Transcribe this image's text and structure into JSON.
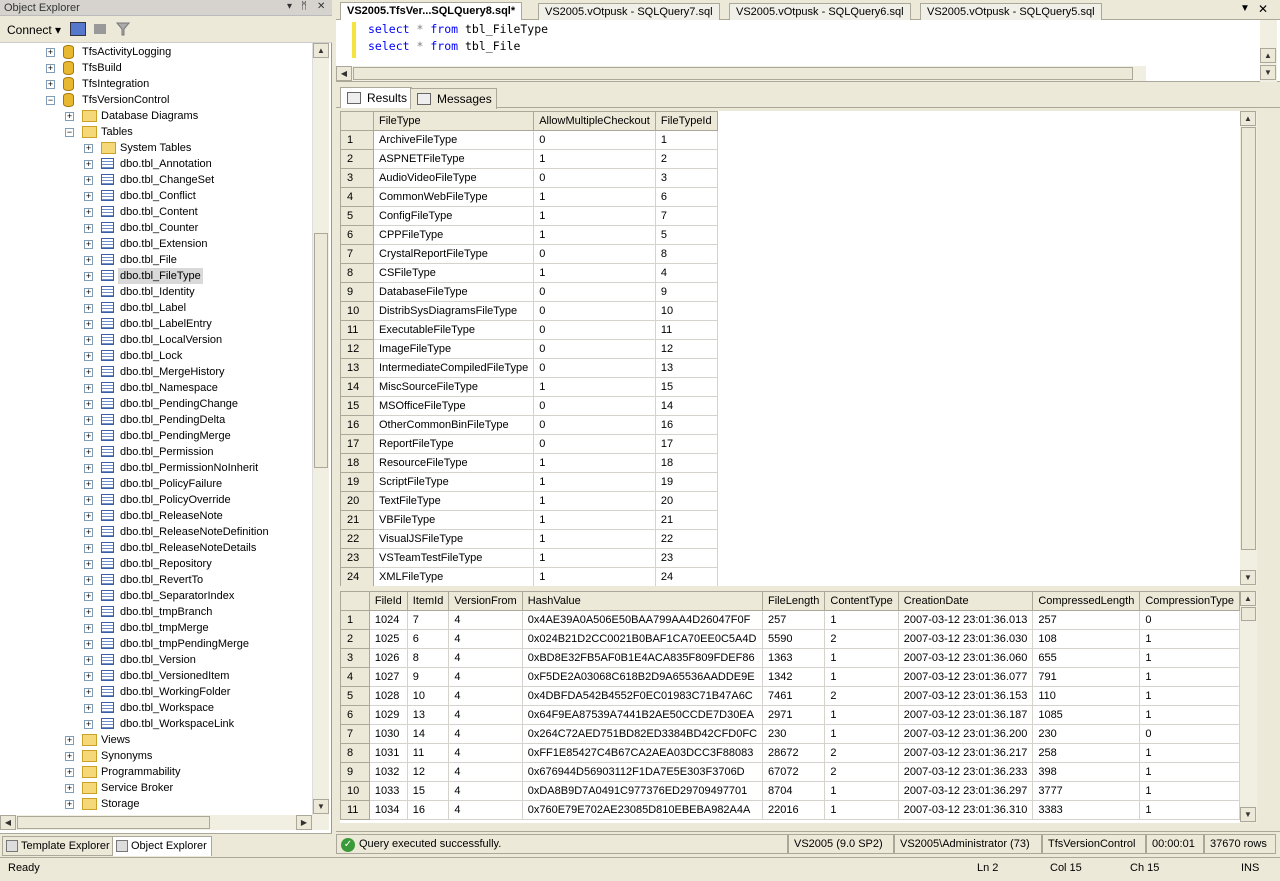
{
  "object_explorer": {
    "title": "Object Explorer",
    "title_controls": [
      "▾",
      "ᛗ",
      "✕"
    ],
    "connect_label": "Connect ▾",
    "tree": [
      {
        "label": "TfsActivityLogging",
        "level": 0,
        "icon": "database-icon",
        "expander": "+"
      },
      {
        "label": "TfsBuild",
        "level": 0,
        "icon": "database-icon",
        "expander": "+"
      },
      {
        "label": "TfsIntegration",
        "level": 0,
        "icon": "database-icon",
        "expander": "+"
      },
      {
        "label": "TfsVersionControl",
        "level": 0,
        "icon": "database-icon",
        "expander": "−"
      },
      {
        "label": "Database Diagrams",
        "level": 1,
        "icon": "folder-icon",
        "expander": "+"
      },
      {
        "label": "Tables",
        "level": 1,
        "icon": "folder-icon",
        "expander": "−"
      },
      {
        "label": "System Tables",
        "level": 2,
        "icon": "folder-icon",
        "expander": "+"
      },
      {
        "label": "dbo.tbl_Annotation",
        "level": 2,
        "icon": "table-icon",
        "expander": "+"
      },
      {
        "label": "dbo.tbl_ChangeSet",
        "level": 2,
        "icon": "table-icon",
        "expander": "+"
      },
      {
        "label": "dbo.tbl_Conflict",
        "level": 2,
        "icon": "table-icon",
        "expander": "+"
      },
      {
        "label": "dbo.tbl_Content",
        "level": 2,
        "icon": "table-icon",
        "expander": "+"
      },
      {
        "label": "dbo.tbl_Counter",
        "level": 2,
        "icon": "table-icon",
        "expander": "+"
      },
      {
        "label": "dbo.tbl_Extension",
        "level": 2,
        "icon": "table-icon",
        "expander": "+"
      },
      {
        "label": "dbo.tbl_File",
        "level": 2,
        "icon": "table-icon",
        "expander": "+"
      },
      {
        "label": "dbo.tbl_FileType",
        "level": 2,
        "icon": "table-icon",
        "expander": "+",
        "selected": true
      },
      {
        "label": "dbo.tbl_Identity",
        "level": 2,
        "icon": "table-icon",
        "expander": "+"
      },
      {
        "label": "dbo.tbl_Label",
        "level": 2,
        "icon": "table-icon",
        "expander": "+"
      },
      {
        "label": "dbo.tbl_LabelEntry",
        "level": 2,
        "icon": "table-icon",
        "expander": "+"
      },
      {
        "label": "dbo.tbl_LocalVersion",
        "level": 2,
        "icon": "table-icon",
        "expander": "+"
      },
      {
        "label": "dbo.tbl_Lock",
        "level": 2,
        "icon": "table-icon",
        "expander": "+"
      },
      {
        "label": "dbo.tbl_MergeHistory",
        "level": 2,
        "icon": "table-icon",
        "expander": "+"
      },
      {
        "label": "dbo.tbl_Namespace",
        "level": 2,
        "icon": "table-icon",
        "expander": "+"
      },
      {
        "label": "dbo.tbl_PendingChange",
        "level": 2,
        "icon": "table-icon",
        "expander": "+"
      },
      {
        "label": "dbo.tbl_PendingDelta",
        "level": 2,
        "icon": "table-icon",
        "expander": "+"
      },
      {
        "label": "dbo.tbl_PendingMerge",
        "level": 2,
        "icon": "table-icon",
        "expander": "+"
      },
      {
        "label": "dbo.tbl_Permission",
        "level": 2,
        "icon": "table-icon",
        "expander": "+"
      },
      {
        "label": "dbo.tbl_PermissionNoInherit",
        "level": 2,
        "icon": "table-icon",
        "expander": "+"
      },
      {
        "label": "dbo.tbl_PolicyFailure",
        "level": 2,
        "icon": "table-icon",
        "expander": "+"
      },
      {
        "label": "dbo.tbl_PolicyOverride",
        "level": 2,
        "icon": "table-icon",
        "expander": "+"
      },
      {
        "label": "dbo.tbl_ReleaseNote",
        "level": 2,
        "icon": "table-icon",
        "expander": "+"
      },
      {
        "label": "dbo.tbl_ReleaseNoteDefinition",
        "level": 2,
        "icon": "table-icon",
        "expander": "+"
      },
      {
        "label": "dbo.tbl_ReleaseNoteDetails",
        "level": 2,
        "icon": "table-icon",
        "expander": "+"
      },
      {
        "label": "dbo.tbl_Repository",
        "level": 2,
        "icon": "table-icon",
        "expander": "+"
      },
      {
        "label": "dbo.tbl_RevertTo",
        "level": 2,
        "icon": "table-icon",
        "expander": "+"
      },
      {
        "label": "dbo.tbl_SeparatorIndex",
        "level": 2,
        "icon": "table-icon",
        "expander": "+"
      },
      {
        "label": "dbo.tbl_tmpBranch",
        "level": 2,
        "icon": "table-icon",
        "expander": "+"
      },
      {
        "label": "dbo.tbl_tmpMerge",
        "level": 2,
        "icon": "table-icon",
        "expander": "+"
      },
      {
        "label": "dbo.tbl_tmpPendingMerge",
        "level": 2,
        "icon": "table-icon",
        "expander": "+"
      },
      {
        "label": "dbo.tbl_Version",
        "level": 2,
        "icon": "table-icon",
        "expander": "+"
      },
      {
        "label": "dbo.tbl_VersionedItem",
        "level": 2,
        "icon": "table-icon",
        "expander": "+"
      },
      {
        "label": "dbo.tbl_WorkingFolder",
        "level": 2,
        "icon": "table-icon",
        "expander": "+"
      },
      {
        "label": "dbo.tbl_Workspace",
        "level": 2,
        "icon": "table-icon",
        "expander": "+"
      },
      {
        "label": "dbo.tbl_WorkspaceLink",
        "level": 2,
        "icon": "table-icon",
        "expander": "+"
      },
      {
        "label": "Views",
        "level": 1,
        "icon": "folder-icon",
        "expander": "+"
      },
      {
        "label": "Synonyms",
        "level": 1,
        "icon": "folder-icon",
        "expander": "+"
      },
      {
        "label": "Programmability",
        "level": 1,
        "icon": "folder-icon",
        "expander": "+"
      },
      {
        "label": "Service Broker",
        "level": 1,
        "icon": "folder-icon",
        "expander": "+"
      },
      {
        "label": "Storage",
        "level": 1,
        "icon": "folder-icon",
        "expander": "+"
      }
    ],
    "bottom_tabs": [
      "Template Explorer",
      "Object Explorer"
    ]
  },
  "doc_tabs": [
    "VS2005.TfsVer...SQLQuery8.sql*",
    "VS2005.vOtpusk - SQLQuery7.sql",
    "VS2005.vOtpusk - SQLQuery6.sql",
    "VS2005.vOtpusk - SQLQuery5.sql"
  ],
  "editor": {
    "line1": {
      "kw1": "select",
      "star": "*",
      "kw2": "from",
      "table": "tbl_FileType"
    },
    "line2": {
      "kw1": "select",
      "star": "*",
      "kw2": "from",
      "table": "tbl_File"
    }
  },
  "result_tabs": [
    "Results",
    "Messages"
  ],
  "grid1": {
    "columns": [
      "FileType",
      "AllowMultipleCheckout",
      "FileTypeId"
    ],
    "rows": [
      [
        "1",
        "ArchiveFileType",
        "0",
        "1"
      ],
      [
        "2",
        "ASPNETFileType",
        "1",
        "2"
      ],
      [
        "3",
        "AudioVideoFileType",
        "0",
        "3"
      ],
      [
        "4",
        "CommonWebFileType",
        "1",
        "6"
      ],
      [
        "5",
        "ConfigFileType",
        "1",
        "7"
      ],
      [
        "6",
        "CPPFileType",
        "1",
        "5"
      ],
      [
        "7",
        "CrystalReportFileType",
        "0",
        "8"
      ],
      [
        "8",
        "CSFileType",
        "1",
        "4"
      ],
      [
        "9",
        "DatabaseFileType",
        "0",
        "9"
      ],
      [
        "10",
        "DistribSysDiagramsFileType",
        "0",
        "10"
      ],
      [
        "11",
        "ExecutableFileType",
        "0",
        "11"
      ],
      [
        "12",
        "ImageFileType",
        "0",
        "12"
      ],
      [
        "13",
        "IntermediateCompiledFileType",
        "0",
        "13"
      ],
      [
        "14",
        "MiscSourceFileType",
        "1",
        "15"
      ],
      [
        "15",
        "MSOfficeFileType",
        "0",
        "14"
      ],
      [
        "16",
        "OtherCommonBinFileType",
        "0",
        "16"
      ],
      [
        "17",
        "ReportFileType",
        "0",
        "17"
      ],
      [
        "18",
        "ResourceFileType",
        "1",
        "18"
      ],
      [
        "19",
        "ScriptFileType",
        "1",
        "19"
      ],
      [
        "20",
        "TextFileType",
        "1",
        "20"
      ],
      [
        "21",
        "VBFileType",
        "1",
        "21"
      ],
      [
        "22",
        "VisualJSFileType",
        "1",
        "22"
      ],
      [
        "23",
        "VSTeamTestFileType",
        "1",
        "23"
      ],
      [
        "24",
        "XMLFileType",
        "1",
        "24"
      ]
    ]
  },
  "grid2": {
    "columns": [
      "FileId",
      "ItemId",
      "VersionFrom",
      "HashValue",
      "FileLength",
      "ContentType",
      "CreationDate",
      "CompressedLength",
      "CompressionType"
    ],
    "rows": [
      [
        "1",
        "1024",
        "7",
        "4",
        "0x4AE39A0A506E50BAA799AA4D26047F0F",
        "257",
        "1",
        "2007-03-12 23:01:36.013",
        "257",
        "0"
      ],
      [
        "2",
        "1025",
        "6",
        "4",
        "0x024B21D2CC0021B0BAF1CA70EE0C5A4D",
        "5590",
        "2",
        "2007-03-12 23:01:36.030",
        "108",
        "1"
      ],
      [
        "3",
        "1026",
        "8",
        "4",
        "0xBD8E32FB5AF0B1E4ACA835F809FDEF86",
        "1363",
        "1",
        "2007-03-12 23:01:36.060",
        "655",
        "1"
      ],
      [
        "4",
        "1027",
        "9",
        "4",
        "0xF5DE2A03068C618B2D9A65536AADDE9E",
        "1342",
        "1",
        "2007-03-12 23:01:36.077",
        "791",
        "1"
      ],
      [
        "5",
        "1028",
        "10",
        "4",
        "0x4DBFDA542B4552F0EC01983C71B47A6C",
        "7461",
        "2",
        "2007-03-12 23:01:36.153",
        "110",
        "1"
      ],
      [
        "6",
        "1029",
        "13",
        "4",
        "0x64F9EA87539A7441B2AE50CCDE7D30EA",
        "2971",
        "1",
        "2007-03-12 23:01:36.187",
        "1085",
        "1"
      ],
      [
        "7",
        "1030",
        "14",
        "4",
        "0x264C72AED751BD82ED3384BD42CFD0FC",
        "230",
        "1",
        "2007-03-12 23:01:36.200",
        "230",
        "0"
      ],
      [
        "8",
        "1031",
        "11",
        "4",
        "0xFF1E85427C4B67CA2AEA03DCC3F88083",
        "28672",
        "2",
        "2007-03-12 23:01:36.217",
        "258",
        "1"
      ],
      [
        "9",
        "1032",
        "12",
        "4",
        "0x676944D56903112F1DA7E5E303F3706D",
        "67072",
        "2",
        "2007-03-12 23:01:36.233",
        "398",
        "1"
      ],
      [
        "10",
        "1033",
        "15",
        "4",
        "0xDA8B9D7A0491C977376ED29709497701",
        "8704",
        "1",
        "2007-03-12 23:01:36.297",
        "3777",
        "1"
      ],
      [
        "11",
        "1034",
        "16",
        "4",
        "0x760E79E702AE23085D810EBEBA982A4A",
        "22016",
        "1",
        "2007-03-12 23:01:36.310",
        "3383",
        "1"
      ]
    ]
  },
  "query_status": {
    "message": "Query executed successfully.",
    "server": "VS2005 (9.0 SP2)",
    "user": "VS2005\\Administrator (73)",
    "database": "TfsVersionControl",
    "elapsed": "00:00:01",
    "rows": "37670 rows"
  },
  "app_status": {
    "state": "Ready",
    "ln": "Ln 2",
    "col": "Col 15",
    "ch": "Ch 15",
    "ins": "INS"
  }
}
